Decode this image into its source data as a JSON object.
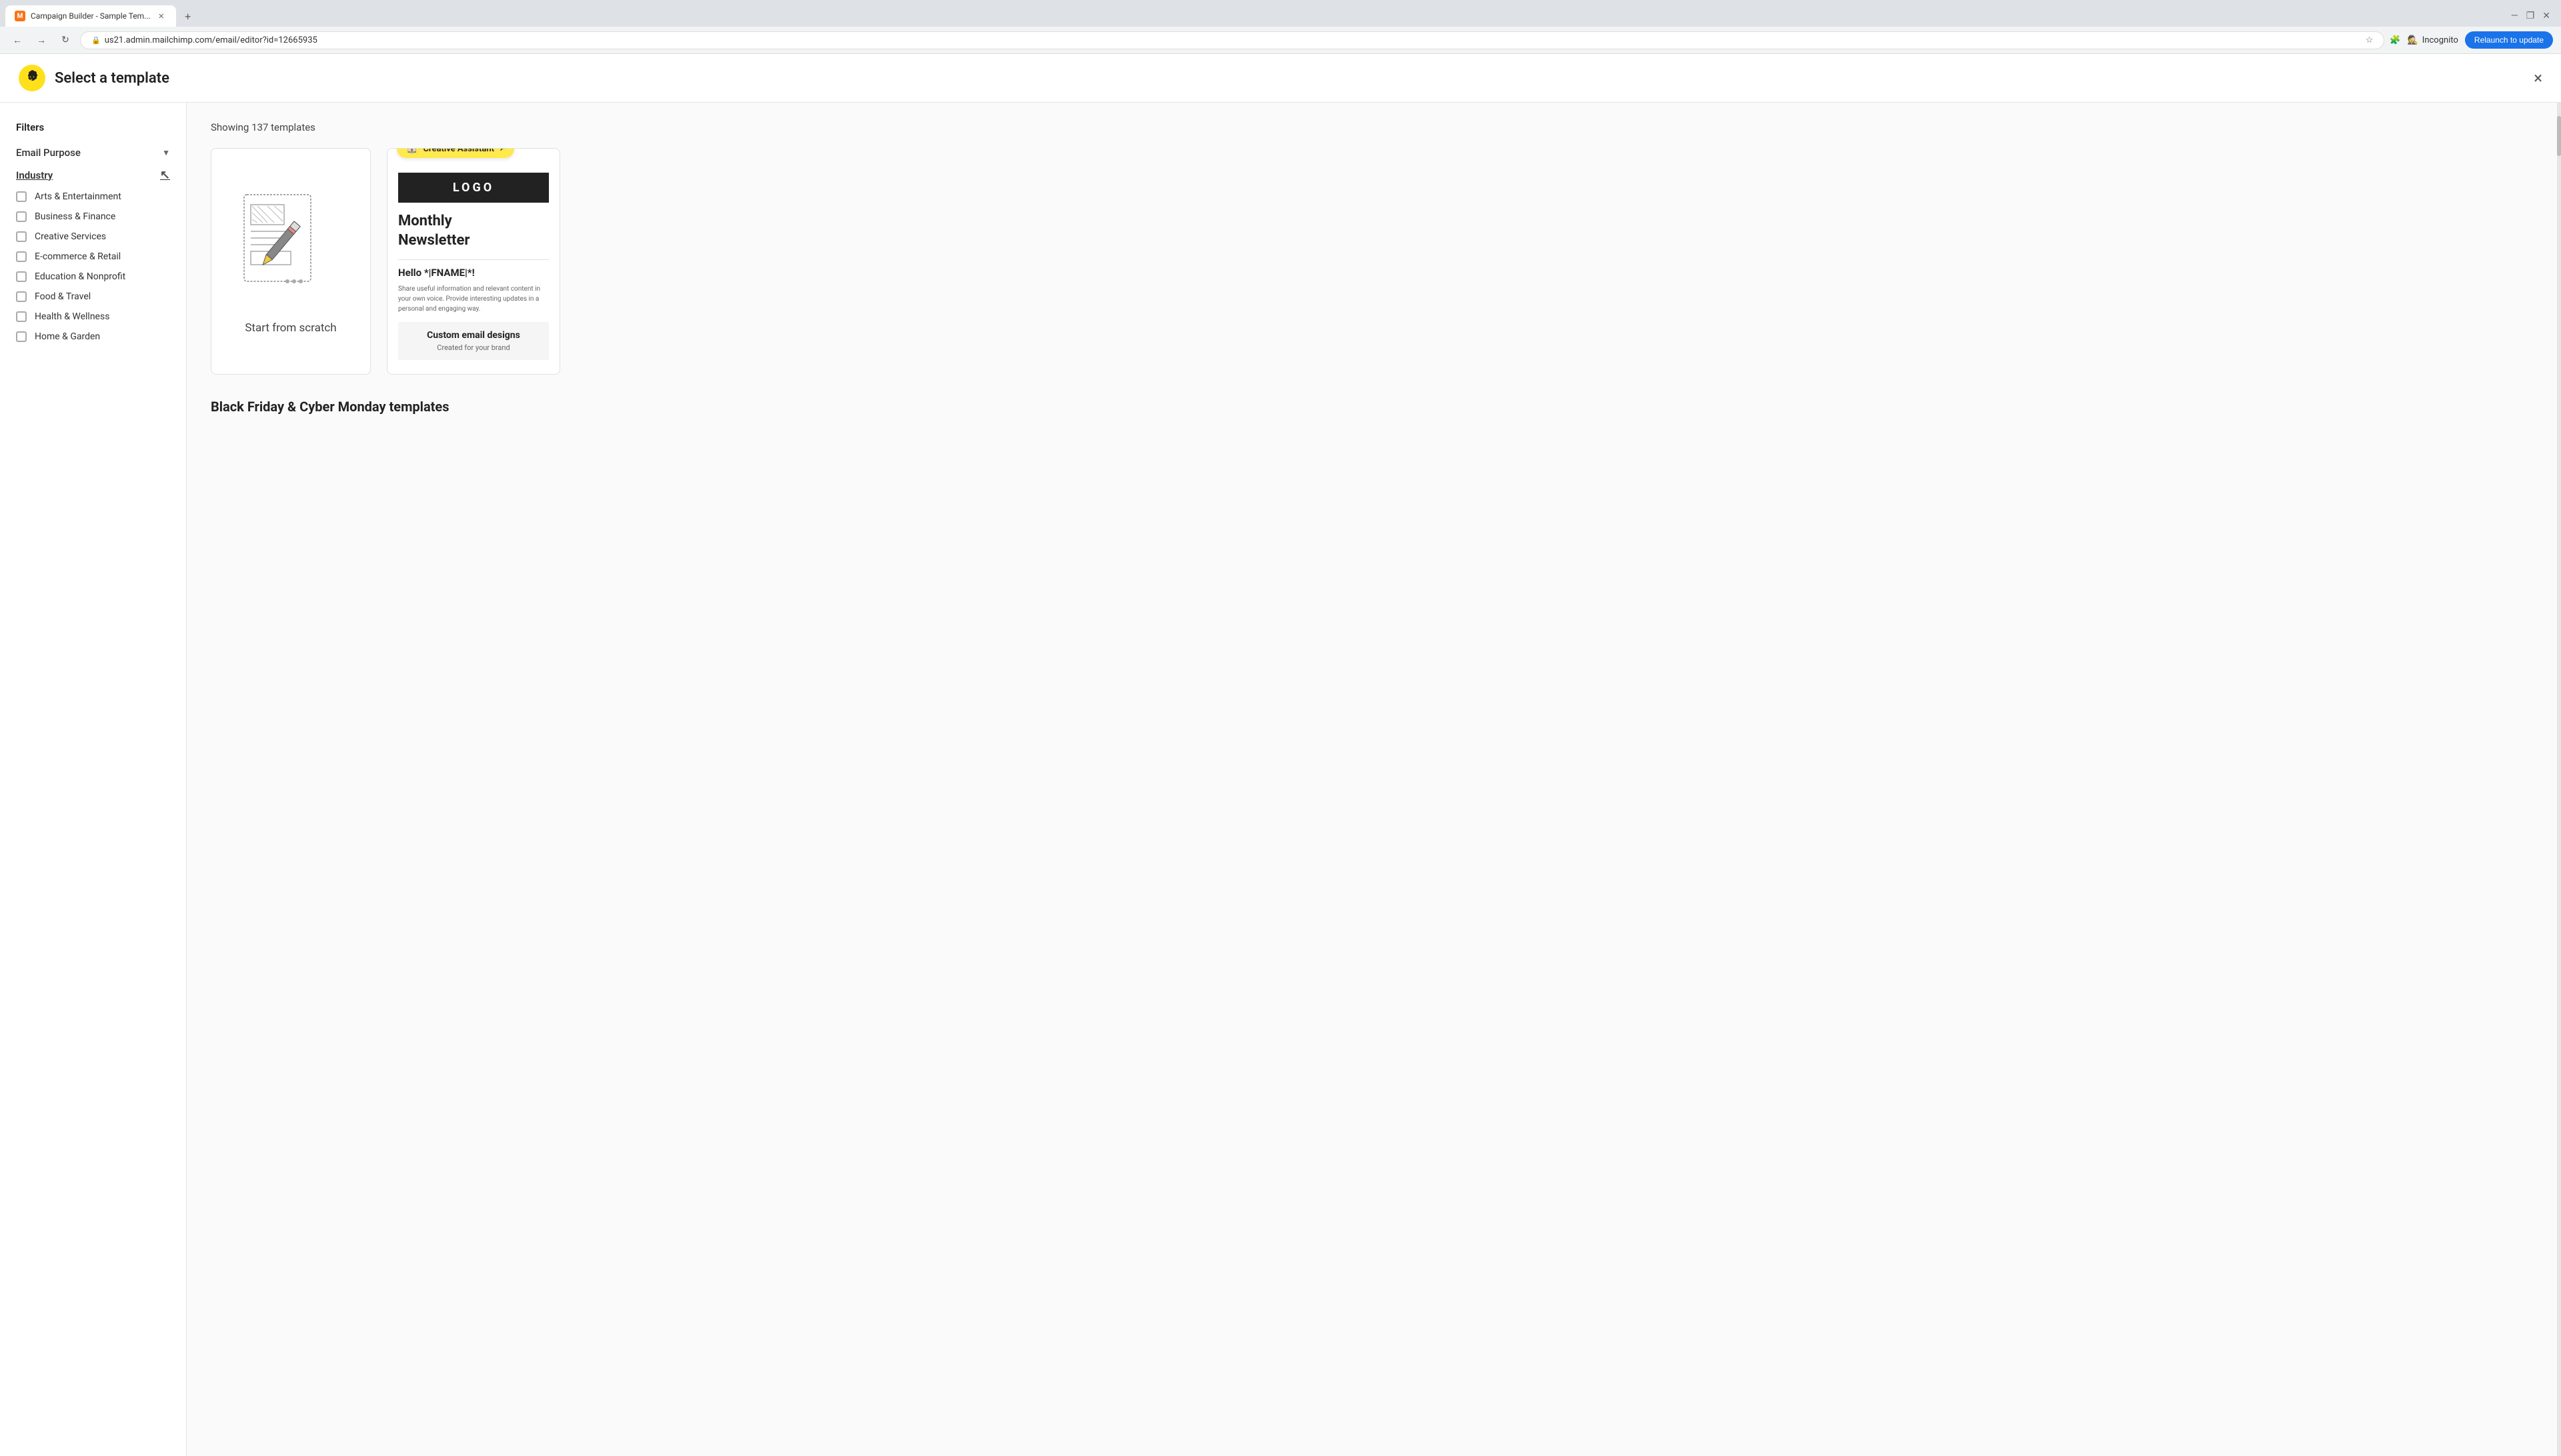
{
  "browser": {
    "tab_title": "Campaign Builder - Sample Tem...",
    "url": "us21.admin.mailchimp.com/email/editor?id=12665935",
    "incognito_label": "Incognito",
    "relaunch_label": "Relaunch to update"
  },
  "app": {
    "page_title": "Select a template",
    "close_label": "×"
  },
  "sidebar": {
    "filters_heading": "Filters",
    "email_purpose_label": "Email Purpose",
    "industry_label": "Industry",
    "filter_items": [
      {
        "label": "Arts & Entertainment",
        "checked": false
      },
      {
        "label": "Business & Finance",
        "checked": false
      },
      {
        "label": "Creative Services",
        "checked": false
      },
      {
        "label": "E-commerce & Retail",
        "checked": false
      },
      {
        "label": "Education & Nonprofit",
        "checked": false
      },
      {
        "label": "Food & Travel",
        "checked": false
      },
      {
        "label": "Health & Wellness",
        "checked": false
      },
      {
        "label": "Home & Garden",
        "checked": false
      }
    ]
  },
  "main": {
    "showing_count": "Showing 137 templates",
    "scratch_card": {
      "label": "Start from scratch"
    },
    "creative_assistant_card": {
      "badge_label": "Creative Assistant",
      "logo_text": "LOGO",
      "newsletter_title": "Monthly\nNewsletter",
      "hello_fname": "Hello *|FNAME|*!",
      "preview_text": "Share useful information and relevant content in your own voice. Provide interesting updates in a personal and engaging way.",
      "custom_email_title": "Custom email designs",
      "custom_email_subtitle": "Created for your brand"
    },
    "black_friday_section": {
      "title": "Black Friday & Cyber Monday templates"
    }
  }
}
